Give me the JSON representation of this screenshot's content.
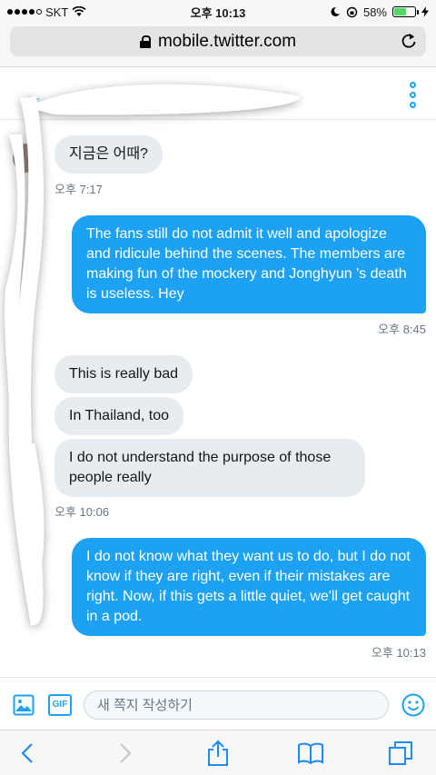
{
  "status_bar": {
    "carrier": "SKT",
    "time": "오후 10:13",
    "battery": "58%",
    "battery_level": 0.58
  },
  "browser": {
    "url": "mobile.twitter.com"
  },
  "header": {
    "back_icon": "arrow-left-icon",
    "more_icon": "vertical-dots-icon"
  },
  "messages": [
    {
      "direction": "in",
      "text": "지금은 어때?"
    },
    {
      "direction": "in",
      "timestamp": "오후 7:17"
    },
    {
      "direction": "out",
      "text": "The fans still do not admit it well and apologize and ridicule behind the scenes. The members are making fun of the mockery and Jonghyun 's death is useless. Hey"
    },
    {
      "direction": "out",
      "timestamp": "오후 8:45"
    },
    {
      "direction": "in",
      "text": "This is really bad"
    },
    {
      "direction": "in",
      "text": "In Thailand, too"
    },
    {
      "direction": "in",
      "text": "I do not understand the purpose of those people really"
    },
    {
      "direction": "in",
      "timestamp": "오후 10:06"
    },
    {
      "direction": "out",
      "text": "I do not know what they want us to do, but I do not know if they are right, even if their mistakes are right. Now, if this gets a little quiet, we'll get caught in a pod."
    },
    {
      "direction": "out",
      "timestamp": "오후 10:13"
    }
  ],
  "composer": {
    "placeholder": "새 쪽지 작성하기",
    "gif_label": "GIF"
  },
  "colors": {
    "accent": "#1da1f2",
    "incoming_bubble": "#e6ecf0",
    "timestamp": "#657786",
    "battery": "#4cd964"
  }
}
